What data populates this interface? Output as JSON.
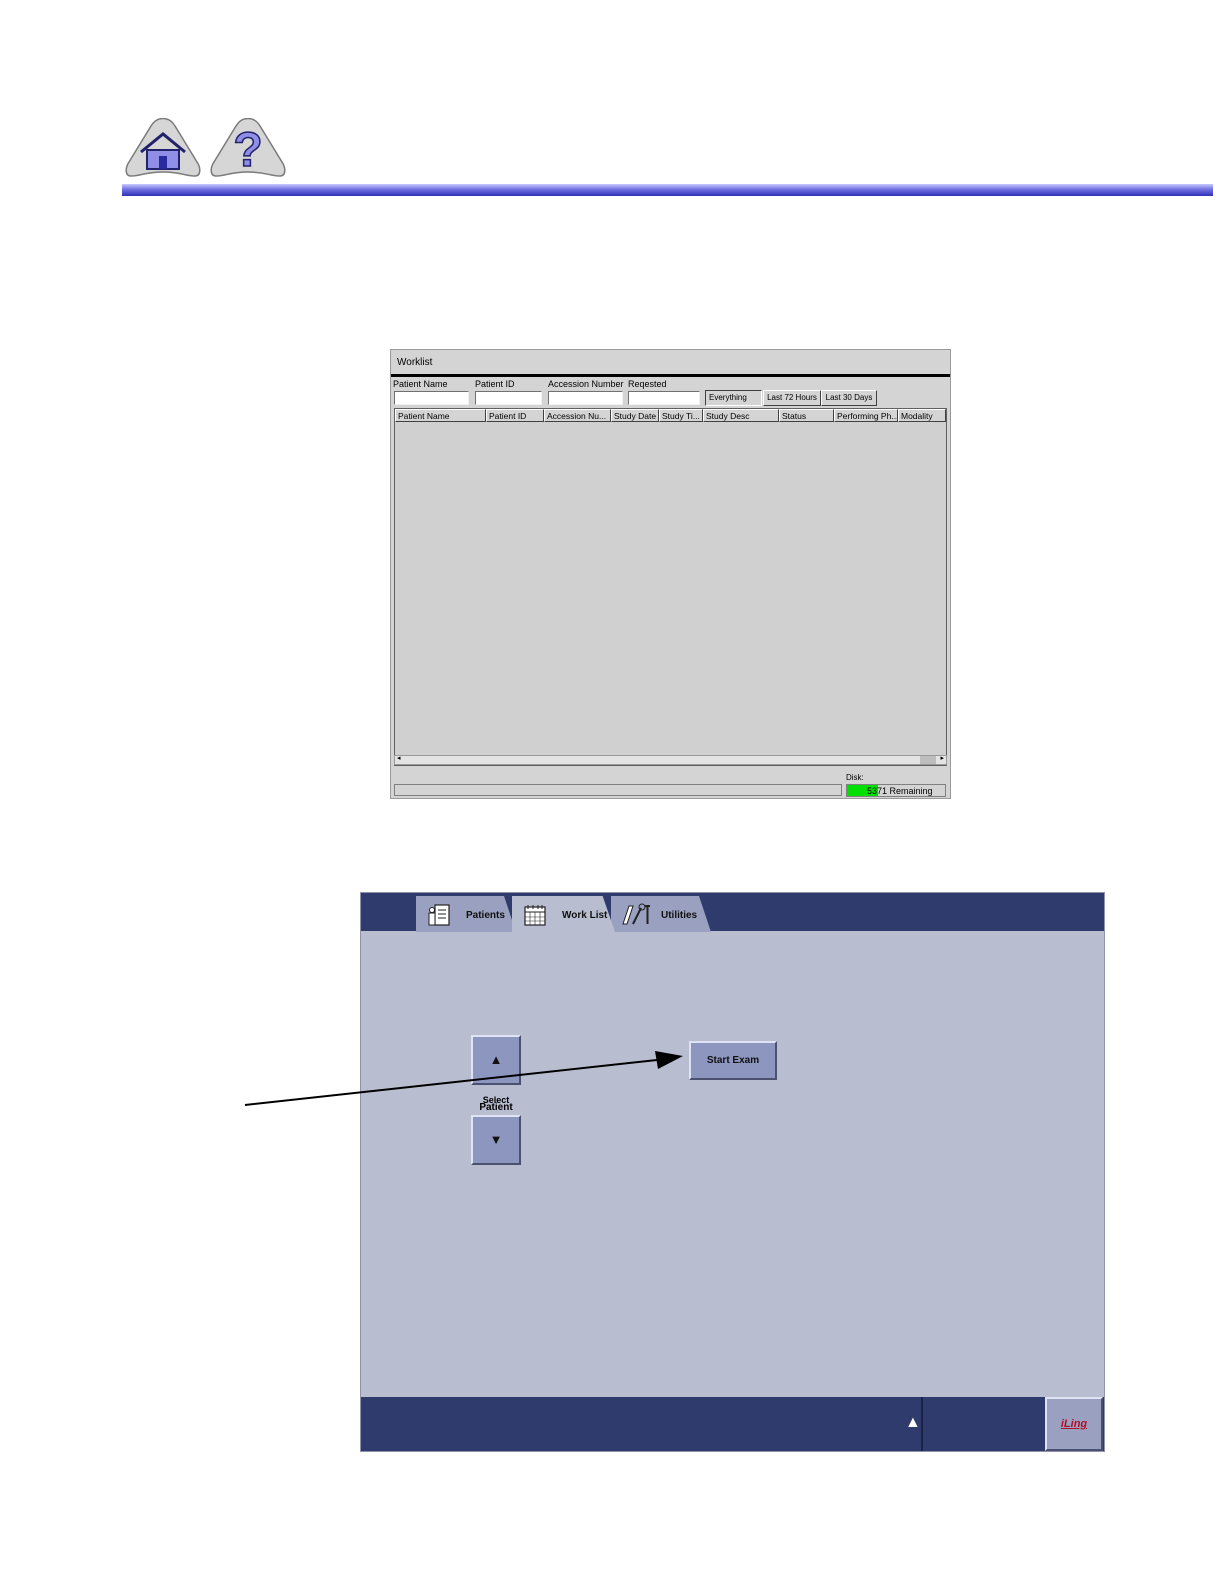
{
  "nav": {
    "home_icon": "home-icon",
    "help_icon": "help-icon",
    "rule_color": "#3030b8"
  },
  "worklist": {
    "title": "Worklist",
    "filters": {
      "patient_name_label": "Patient Name",
      "patient_id_label": "Patient ID",
      "accession_label": "Accession Number",
      "requested_label": "Reqested",
      "patient_name_value": "",
      "patient_id_value": "",
      "accession_value": "",
      "requested_value": "",
      "everything_label": "Everything",
      "last72_label": "Last 72 Hours",
      "last30_label": "Last 30 Days"
    },
    "columns": [
      "Patient Name",
      "Patient ID",
      "Accession Nu...",
      "Study Date",
      "Study Ti...",
      "Study Desc",
      "Status",
      "Performing Ph...",
      "Modality"
    ],
    "rows": [],
    "disk": {
      "label": "Disk:",
      "remaining_text": "5371 Remaining",
      "fill_fraction": 0.32,
      "fill_color": "#00e000"
    }
  },
  "app": {
    "tabs": [
      {
        "label": "Patients",
        "icon": "patient-chart-icon",
        "active": false
      },
      {
        "label": "Work List",
        "icon": "calendar-icon",
        "active": true
      },
      {
        "label": "Utilities",
        "icon": "tools-icon",
        "active": false
      }
    ],
    "select_patient": {
      "line1": "Select",
      "line2": "Patient",
      "up_glyph": "▲",
      "down_glyph": "▼"
    },
    "start_exam_label": "Start Exam",
    "bottom_arrow_glyph": "▲",
    "brand_label": "iLing",
    "colors": {
      "bar": "#2e3b6c",
      "panel": "#b9bdd0",
      "button": "#8d96bf"
    }
  }
}
